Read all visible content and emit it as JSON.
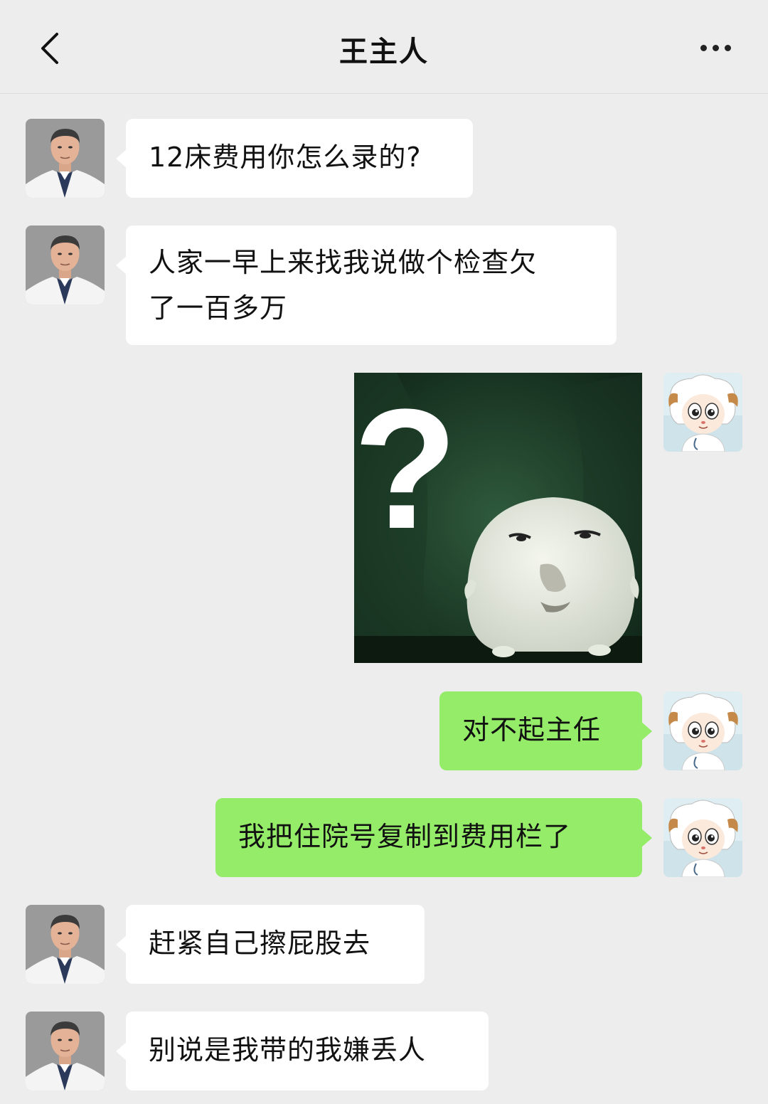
{
  "header": {
    "title": "王主人",
    "back_icon": "chevron-left-icon",
    "more_icon": "more-dots-icon"
  },
  "contact": {
    "avatar": "doctor-avatar"
  },
  "me": {
    "avatar": "cartoon-sheep-avatar"
  },
  "messages": [
    {
      "from": "contact",
      "text": "12床费用你怎么录的?"
    },
    {
      "from": "contact",
      "lines": [
        "人家一早上来找我说做个检查欠",
        "了一百多万"
      ]
    },
    {
      "from": "me",
      "type": "sticker",
      "sticker_text": "?"
    },
    {
      "from": "me",
      "text": "对不起主任"
    },
    {
      "from": "me",
      "text": "我把住院号复制到费用栏了"
    },
    {
      "from": "contact",
      "text": "赶紧自己擦屁股去"
    },
    {
      "from": "contact",
      "text": "别说是我带的我嫌丢人"
    }
  ],
  "colors": {
    "background": "#ededed",
    "incoming_bubble": "#ffffff",
    "outgoing_bubble": "#95ec69"
  }
}
